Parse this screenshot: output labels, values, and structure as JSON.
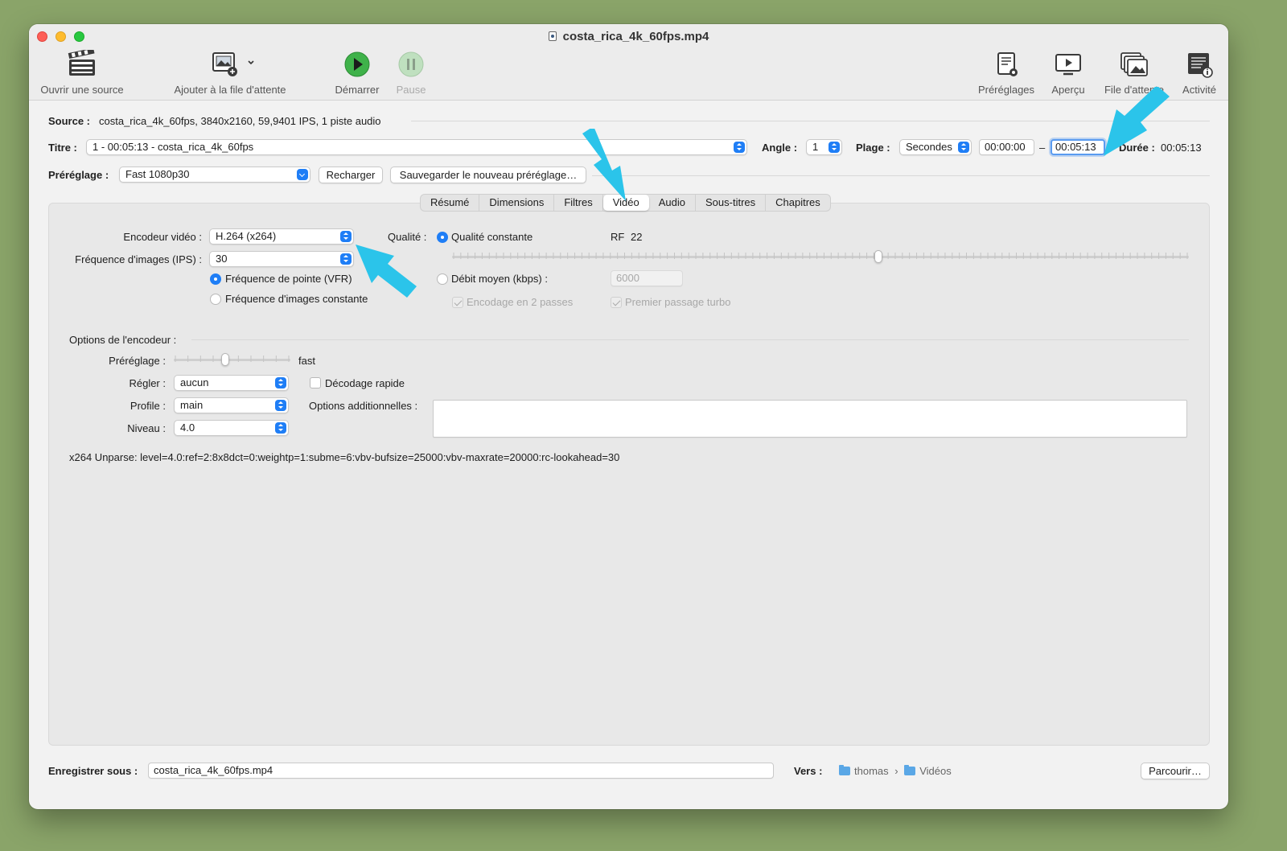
{
  "window": {
    "title": "costa_rica_4k_60fps.mp4"
  },
  "toolbar": {
    "open_source": "Ouvrir une source",
    "add_queue": "Ajouter à la file d'attente",
    "start": "Démarrer",
    "pause": "Pause",
    "presets": "Préréglages",
    "preview": "Aperçu",
    "queue": "File d'attente",
    "activity": "Activité"
  },
  "source": {
    "label": "Source :",
    "value": "costa_rica_4k_60fps, 3840x2160, 59,9401 IPS, 1 piste audio"
  },
  "title_row": {
    "label": "Titre :",
    "value": "1 - 00:05:13 - costa_rica_4k_60fps",
    "angle_label": "Angle :",
    "angle_value": "1",
    "range_label": "Plage :",
    "range_value": "Secondes",
    "range_start": "00:00:00",
    "range_dash": "–",
    "range_end": "00:05:13",
    "duration_label": "Durée :",
    "duration_value": "00:05:13"
  },
  "preset_row": {
    "label": "Préréglage :",
    "value": "Fast 1080p30",
    "reload": "Recharger",
    "save_new": "Sauvegarder le nouveau préréglage…"
  },
  "tabs": [
    "Résumé",
    "Dimensions",
    "Filtres",
    "Vidéo",
    "Audio",
    "Sous-titres",
    "Chapitres"
  ],
  "active_tab": "Vidéo",
  "video": {
    "encoder_label": "Encodeur vidéo :",
    "encoder_value": "H.264 (x264)",
    "fps_label": "Fréquence d'images (IPS) :",
    "fps_value": "30",
    "vfr_label": "Fréquence de pointe (VFR)",
    "cfr_label": "Fréquence d'images constante",
    "quality_label": "Qualité :",
    "cq_label": "Qualité constante",
    "rf_label": "RF",
    "rf_value": "22",
    "rf_fraction": 0.58,
    "abr_label": "Débit moyen (kbps) :",
    "abr_value": "6000",
    "twopass_label": "Encodage en 2 passes",
    "turbo_label": "Premier passage turbo"
  },
  "encoder_options": {
    "section_label": "Options de l'encodeur :",
    "preset_label": "Préréglage :",
    "preset_value": "fast",
    "preset_fraction": 0.44,
    "tune_label": "Régler :",
    "tune_value": "aucun",
    "fastdecode_label": "Décodage rapide",
    "profile_label": "Profile :",
    "profile_value": "main",
    "extra_label": "Options additionnelles :",
    "level_label": "Niveau :",
    "level_value": "4.0",
    "unparse": "x264 Unparse: level=4.0:ref=2:8x8dct=0:weightp=1:subme=6:vbv-bufsize=25000:vbv-maxrate=20000:rc-lookahead=30"
  },
  "save": {
    "label": "Enregistrer sous :",
    "value": "costa_rica_4k_60fps.mp4",
    "dest_label": "Vers :",
    "path": [
      "thomas",
      "Vidéos"
    ],
    "path_sep": "›",
    "browse": "Parcourir…"
  },
  "colors": {
    "accent": "#1f7ef6",
    "annotation_arrow": "#2bc4ea",
    "background": "#8aa469"
  }
}
